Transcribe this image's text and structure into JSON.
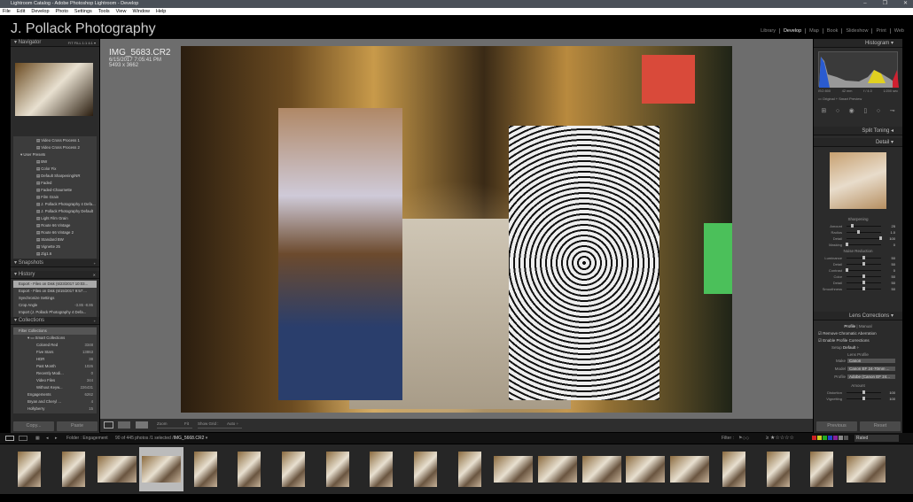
{
  "window": {
    "title": "Lightroom Catalog - Adobe Photoshop Lightroom - Develop",
    "controls": [
      "–",
      "❐",
      "✕"
    ]
  },
  "menu": [
    "File",
    "Edit",
    "Develop",
    "Photo",
    "Settings",
    "Tools",
    "View",
    "Window",
    "Help"
  ],
  "identity": "J. Pollack Photography",
  "modules": [
    {
      "label": "Library"
    },
    {
      "label": "Develop",
      "active": true
    },
    {
      "label": "Map"
    },
    {
      "label": "Book"
    },
    {
      "label": "Slideshow"
    },
    {
      "label": "Print"
    },
    {
      "label": "Web"
    }
  ],
  "navigator": {
    "title": "Navigator",
    "zoom_options": "FIT  FILL  1:1  4:1 ▾"
  },
  "presets": [
    {
      "label": "Video Cross Process 1"
    },
    {
      "label": "Video Cross Process 2"
    },
    {
      "label": "User Presets",
      "folder": true
    },
    {
      "label": "BW"
    },
    {
      "label": "Color Fix"
    },
    {
      "label": "Default Sharpening/NR"
    },
    {
      "label": "Faded"
    },
    {
      "label": "Faded-Chaurnette"
    },
    {
      "label": "Film Grain"
    },
    {
      "label": "J. Pollack Photography 4 Defa..."
    },
    {
      "label": "J. Pollack Photography Default"
    },
    {
      "label": "Light Film Grain"
    },
    {
      "label": "Route 66 Vintage"
    },
    {
      "label": "Route 66 Vintage 2"
    },
    {
      "label": "Standard BW"
    },
    {
      "label": "Vignette 25"
    },
    {
      "label": "Zig1.6"
    }
  ],
  "snapshots": {
    "title": "Snapshots"
  },
  "history": {
    "title": "History",
    "items": [
      {
        "label": "Export - Files on Disk (6/23/2017 10:03...",
        "selected": true
      },
      {
        "label": "Export - Files on Disk (6/15/2017 9:57:..."
      },
      {
        "label": "Synchronize Settings"
      },
      {
        "label": "Crop Angle",
        "a": "-3.86",
        "b": "-8.86"
      },
      {
        "label": "Import (J. Pollack Photography 4 Defa..."
      }
    ]
  },
  "collections": {
    "title": "Collections",
    "filter": "Filter Collections",
    "smart": "Smart Collections",
    "smart_items": [
      {
        "label": "Colored Red",
        "count": "3348"
      },
      {
        "label": "Five Stars",
        "count": "13863"
      },
      {
        "label": "HDR",
        "count": "38"
      },
      {
        "label": "Past Month",
        "count": "1026"
      },
      {
        "label": "Recently Modi...",
        "count": "0"
      },
      {
        "label": "Video Files",
        "count": "344"
      },
      {
        "label": "Without Keyw...",
        "count": "226431"
      }
    ],
    "items": [
      {
        "label": "Engagements",
        "count": "6262"
      },
      {
        "label": "Bryan and Cheryl ...",
        "count": "4"
      },
      {
        "label": "Hollyberry",
        "count": "15"
      }
    ]
  },
  "buttons": {
    "copy": "Copy...",
    "paste": "Paste",
    "previous": "Previous",
    "reset": "Reset"
  },
  "photo": {
    "filename": "IMG_5683.CR2",
    "datetime": "6/15/2017 7:05:41 PM",
    "dimensions": "5493 x 3662"
  },
  "histogram": {
    "title": "Histogram",
    "iso": "ISO 800",
    "focal": "42 mm",
    "aperture": "f / 4.0",
    "shutter": "1/200 sec",
    "preview": "Original + Smart Preview"
  },
  "panels": {
    "split_toning": "Split Toning",
    "detail": "Detail",
    "lens": "Lens Corrections"
  },
  "sharpening": {
    "title": "Sharpening",
    "sliders": [
      {
        "label": "Amount",
        "value": 25
      },
      {
        "label": "Radius",
        "value": "1.0"
      },
      {
        "label": "Detail",
        "value": 100
      },
      {
        "label": "Masking",
        "value": 0
      }
    ]
  },
  "noise": {
    "title": "Noise Reduction",
    "sliders": [
      {
        "label": "Luminance",
        "value": 50
      },
      {
        "label": "Detail",
        "value": 50
      },
      {
        "label": "Contrast",
        "value": 0
      },
      {
        "label": "Color",
        "value": 50
      },
      {
        "label": "Detail",
        "value": 50
      },
      {
        "label": "Smoothness",
        "value": 50
      }
    ]
  },
  "lens": {
    "tabs": [
      "Profile",
      "Manual"
    ],
    "chromatic": "Remove Chromatic Aberration",
    "profile_corr": "Enable Profile Corrections",
    "setup_label": "Setup",
    "setup": "Default ÷",
    "lens_profile": "Lens Profile",
    "make_label": "Make",
    "make": "Canon",
    "model_label": "Model",
    "model": "Canon EF 24-70mm ...",
    "profile_label": "Profile",
    "profile": "Adobe (Canon EF 24...",
    "amount": "Amount",
    "sliders": [
      {
        "label": "Distortion",
        "value": 100
      },
      {
        "label": "Vignetting",
        "value": 100
      }
    ]
  },
  "toolbar": {
    "zoom": "Zoom",
    "fit": "Fit",
    "show_grid": "Show Grid :",
    "auto": "Auto ÷"
  },
  "filmstrip": {
    "folder": "Folder : Engagement",
    "status": "90 of 445 photos /1 selected /",
    "selected": "IMG_5668.CR2",
    "filter": "Filter :",
    "rated": "Rated",
    "count": 20,
    "selected_index": 3
  }
}
